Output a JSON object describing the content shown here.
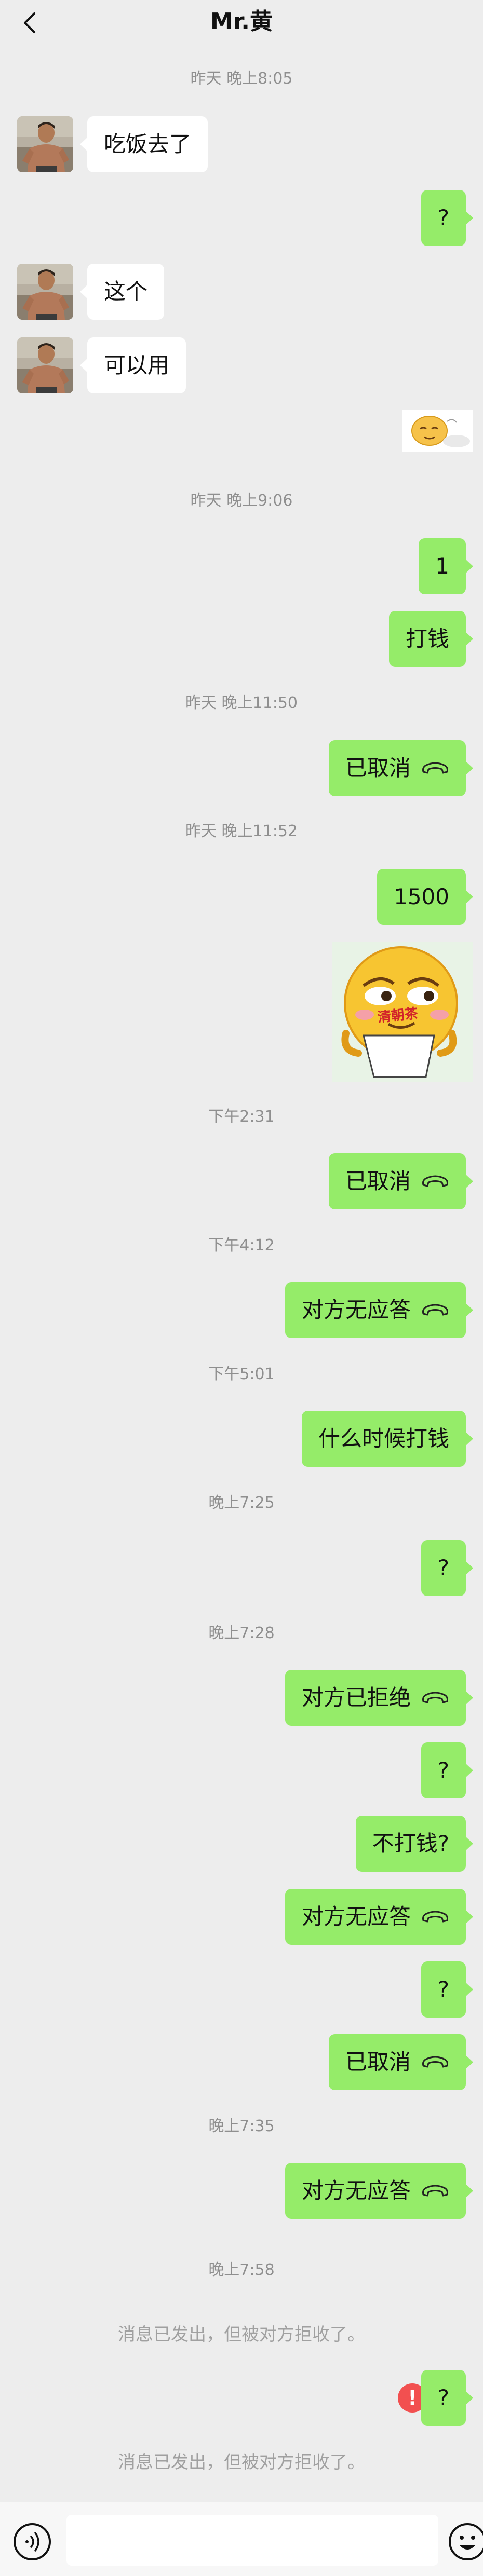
{
  "header": {
    "title": "Mr.黄",
    "back_icon": "back-chevron-icon"
  },
  "colors": {
    "background": "#ededed",
    "outgoing_bubble": "#95ec69",
    "incoming_bubble": "#ffffff",
    "error": "#f25050"
  },
  "messages": {
    "t1": "昨天 晚上8:05",
    "m1": "吃饭去了",
    "m2": "?",
    "m3": "这个",
    "m4": "可以用",
    "t2": "昨天 晚上9:06",
    "m6": "1",
    "m7": "打钱",
    "t3": "昨天 晚上11:50",
    "m8": "已取消",
    "t4": "昨天 晚上11:52",
    "m9": "1500",
    "sticker2_text": "清朝茶",
    "t5": "下午2:31",
    "m11": "已取消",
    "t6": "下午4:12",
    "m12": "对方无应答",
    "t7": "下午5:01",
    "m13": "什么时候打钱",
    "t8": "晚上7:25",
    "m14": "?",
    "t9": "晚上7:28",
    "m15": "对方已拒绝",
    "m16": "?",
    "m17": "不打钱?",
    "m18": "对方无应答",
    "m19": "?",
    "m20": "已取消",
    "t10": "晚上7:35",
    "m21": "对方无应答",
    "t11": "晚上7:58",
    "n1": "消息已发出，但被对方拒收了。",
    "m22": "?",
    "err": "!",
    "n2": "消息已发出，但被对方拒收了。"
  },
  "footer": {
    "voice_icon": "voice-icon",
    "emoji_icon": "emoji-icon"
  }
}
